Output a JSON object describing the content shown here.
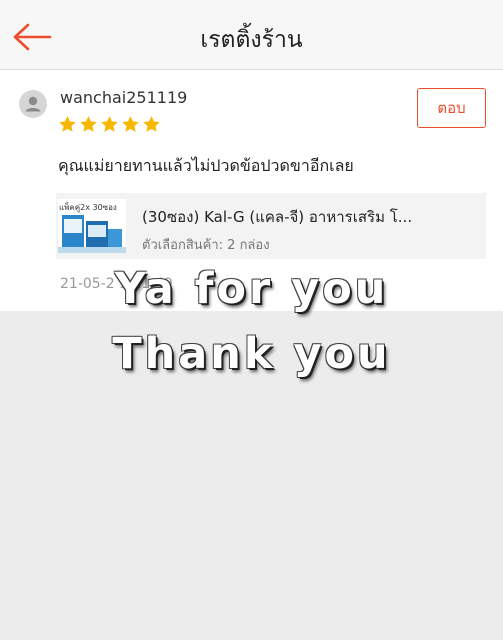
{
  "header": {
    "title": "เรตติ้งร้าน",
    "back_icon": "arrow-left-icon",
    "accent_color": "#ee4d2d"
  },
  "review": {
    "avatar_icon": "user-avatar-icon",
    "username": "wanchai251119",
    "rating": 5,
    "rating_max": 5,
    "star_color": "#f6b700",
    "reply_label": "ตอบ",
    "comment": "คุณแม่ยายทานแล้วไม่ปวดข้อปวดขาอีกเลย",
    "product": {
      "thumbnail_caption": "แพ็คคู่2x 30ซอง",
      "name": "(30ซอง) Kal-G (แคล-จี) อาหารเสริม โ...",
      "variation": "ตัวเลือกสินค้า: 2 กล่อง"
    },
    "timestamp": "21-05-2 9 11:49"
  },
  "overlay": {
    "line1": "Ya for you",
    "line2": "Thank you"
  }
}
